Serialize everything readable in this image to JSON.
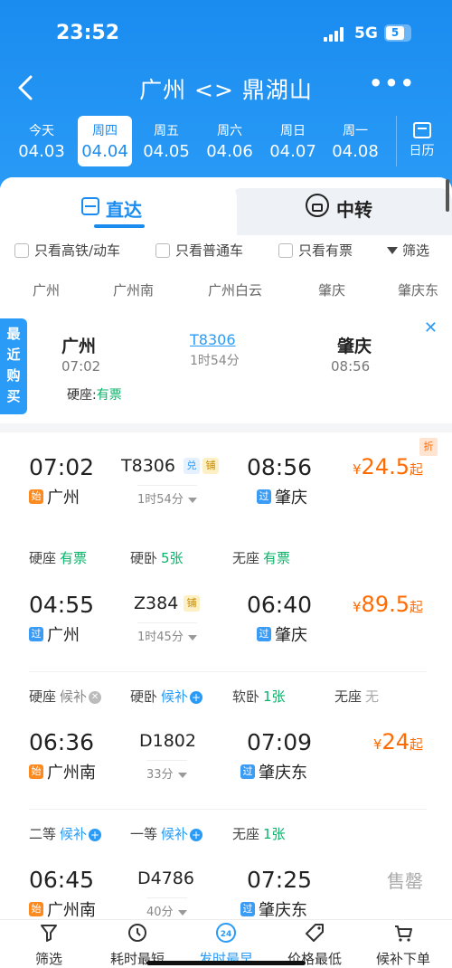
{
  "status_bar": {
    "time": "23:52",
    "network": "5G",
    "battery": "5"
  },
  "nav": {
    "title": "广州 <> 鼎湖山",
    "more": "•••"
  },
  "dates": [
    {
      "weekday": "今天",
      "date": "04.03",
      "active": false
    },
    {
      "weekday": "周四",
      "date": "04.04",
      "active": true
    },
    {
      "weekday": "周五",
      "date": "04.05",
      "active": false
    },
    {
      "weekday": "周六",
      "date": "04.06",
      "active": false
    },
    {
      "weekday": "周日",
      "date": "04.07",
      "active": false
    },
    {
      "weekday": "周一",
      "date": "04.08",
      "active": false
    }
  ],
  "calendar_label": "日历",
  "tabs": {
    "direct": "直达",
    "transfer": "中转"
  },
  "filters": {
    "high_speed": "只看高铁/动车",
    "normal": "只看普通车",
    "available": "只看有票",
    "filter_button": "筛选"
  },
  "stations": [
    "广州",
    "广州南",
    "广州白云",
    "肇庆",
    "肇庆东"
  ],
  "recent": {
    "tag": "最近购买",
    "tag_chars": [
      "最",
      "近",
      "购",
      "买"
    ],
    "from": "广州",
    "from_time": "07:02",
    "train_no": "T8306",
    "duration": "1时54分",
    "to": "肇庆",
    "to_time": "08:56",
    "seat_label": "硬座:",
    "seat_status": "有票",
    "close": "✕"
  },
  "trains": [
    {
      "dep": "07:02",
      "arr": "08:56",
      "no": "T8306",
      "flags": [
        "兑",
        "铺"
      ],
      "duration": "1时54分",
      "from_badge": "始",
      "from": "广州",
      "to_badge": "过",
      "to": "肇庆",
      "price_symbol": "¥",
      "price": "24.5",
      "price_suffix": "起",
      "discount": "折",
      "seats": [
        {
          "label": "硬座",
          "status": "有票",
          "type": "avail"
        },
        {
          "label": "硬卧",
          "status": "5张",
          "type": "avail"
        },
        {
          "label": "无座",
          "status": "有票",
          "type": "avail"
        }
      ]
    },
    {
      "dep": "04:55",
      "arr": "06:40",
      "no": "Z384",
      "flags": [
        "铺"
      ],
      "duration": "1时45分",
      "from_badge": "过",
      "from": "广州",
      "to_badge": "过",
      "to": "肇庆",
      "price_symbol": "¥",
      "price": "89.5",
      "price_suffix": "起",
      "seats": [
        {
          "label": "硬座",
          "status": "候补",
          "type": "grey-x"
        },
        {
          "label": "硬卧",
          "status": "候补",
          "type": "wait-plus"
        },
        {
          "label": "软卧",
          "status": "1张",
          "type": "avail"
        },
        {
          "label": "无座",
          "status": "无",
          "type": "grey"
        }
      ]
    },
    {
      "dep": "06:36",
      "arr": "07:09",
      "no": "D1802",
      "flags": [],
      "duration": "33分",
      "from_badge": "始",
      "from": "广州南",
      "to_badge": "过",
      "to": "肇庆东",
      "price_symbol": "¥",
      "price": "24",
      "price_suffix": "起",
      "seats": [
        {
          "label": "二等",
          "status": "候补",
          "type": "wait-plus"
        },
        {
          "label": "一等",
          "status": "候补",
          "type": "wait-plus"
        },
        {
          "label": "无座",
          "status": "1张",
          "type": "avail"
        }
      ]
    },
    {
      "dep": "06:45",
      "arr": "07:25",
      "no": "D4786",
      "flags": [],
      "duration": "40分",
      "from_badge": "始",
      "from": "广州南",
      "to_badge": "过",
      "to": "肇庆东",
      "sold_out": "售罄",
      "seats": []
    }
  ],
  "bottom_bar": [
    {
      "label": "筛选",
      "icon": "filter-icon",
      "active": false
    },
    {
      "label": "耗时最短",
      "icon": "clock-icon",
      "active": false
    },
    {
      "label": "发时最早",
      "icon": "24h-icon",
      "active": true
    },
    {
      "label": "价格最低",
      "icon": "price-tag-icon",
      "active": false
    },
    {
      "label": "候补下单",
      "icon": "cart-icon",
      "active": false
    }
  ],
  "colors": {
    "primary": "#1a8cf0",
    "price": "#ff6b00",
    "available": "#0ab36a"
  }
}
